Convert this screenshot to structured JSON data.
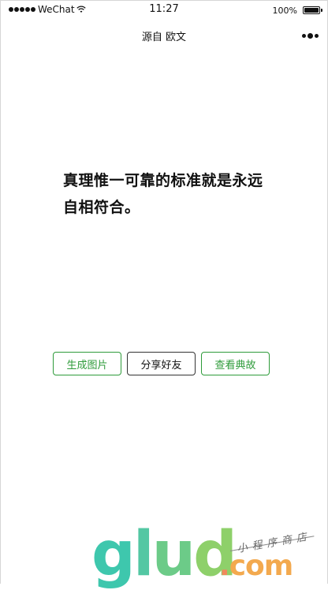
{
  "status_bar": {
    "carrier": "WeChat",
    "time": "11:27",
    "battery": "100%"
  },
  "nav": {
    "title": "源自 欧文"
  },
  "quote": {
    "line1": "真理惟一可靠的标准就是永远",
    "line2": "自相符合。"
  },
  "actions": {
    "generate_image": "生成图片",
    "share_friend": "分享好友",
    "view_source": "查看典故"
  },
  "watermark": {
    "g": "g",
    "l": "l",
    "u": "u",
    "d": "d",
    "dot": ".",
    "com": "com",
    "tagline": "小程序商店"
  },
  "colors": {
    "accent_green": "#2e9b3a"
  }
}
